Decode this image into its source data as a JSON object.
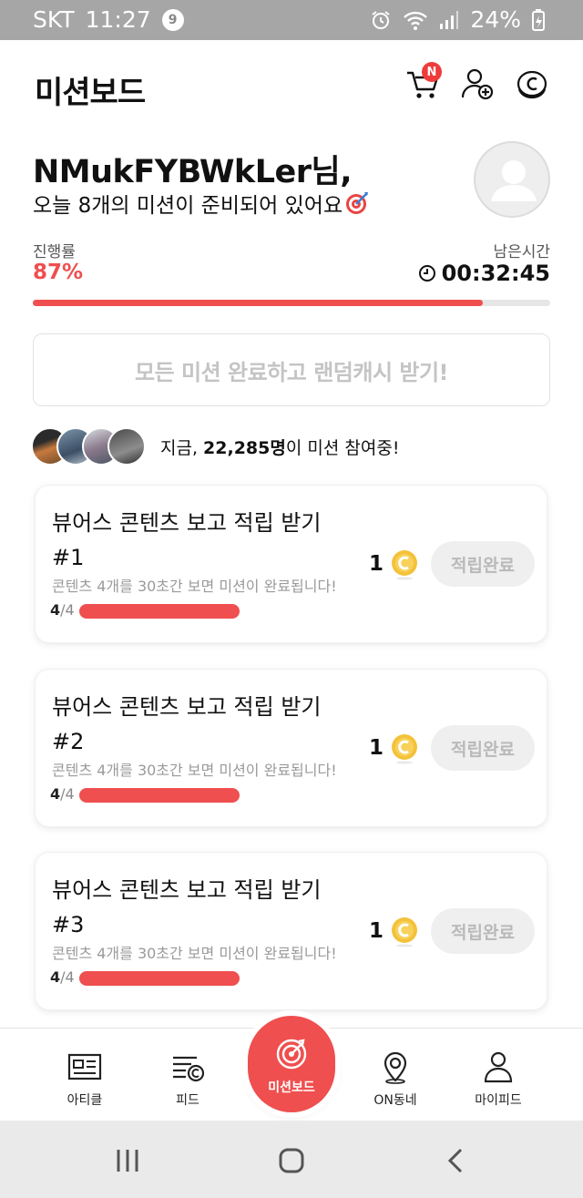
{
  "status_bar": {
    "carrier": "SKT",
    "time": "11:27",
    "notification_count": "9",
    "battery": "24%"
  },
  "header": {
    "title": "미션보드",
    "cart_badge": "N"
  },
  "greeting": {
    "name": "NMukFYBWkLer님,",
    "subtitle": "오늘 8개의 미션이 준비되어 있어요"
  },
  "progress": {
    "label": "진행률",
    "value": "87%",
    "fraction": 0.87,
    "remaining_label": "남은시간",
    "remaining_time": "00:32:45"
  },
  "random_cash_button": "모든 미션 완료하고 랜덤캐시 받기!",
  "participants": {
    "prefix": "지금, ",
    "count": "22,285명",
    "suffix": "이 미션 참여중!"
  },
  "missions": [
    {
      "title": "뷰어스 콘텐츠 보고 적립 받기#1",
      "desc": "콘텐츠 4개를 30초간 보면 미션이 완료됩니다!",
      "done": "4",
      "total": "/4",
      "reward": "1",
      "button": "적립완료"
    },
    {
      "title": "뷰어스 콘텐츠 보고 적립 받기#2",
      "desc": "콘텐츠 4개를 30초간 보면 미션이 완료됩니다!",
      "done": "4",
      "total": "/4",
      "reward": "1",
      "button": "적립완료"
    },
    {
      "title": "뷰어스 콘텐츠 보고 적립 받기#3",
      "desc": "콘텐츠 4개를 30초간 보면 미션이 완료됩니다!",
      "done": "4",
      "total": "/4",
      "reward": "1",
      "button": "적립완료"
    }
  ],
  "bottom_nav": {
    "article": "아티클",
    "feed": "피드",
    "missionboard": "미션보드",
    "neighborhood": "ON동네",
    "myfeed": "마이피드"
  },
  "colors": {
    "accent": "#ef4f4f",
    "muted": "#c4c4c4",
    "coin": "#f4c23a"
  }
}
